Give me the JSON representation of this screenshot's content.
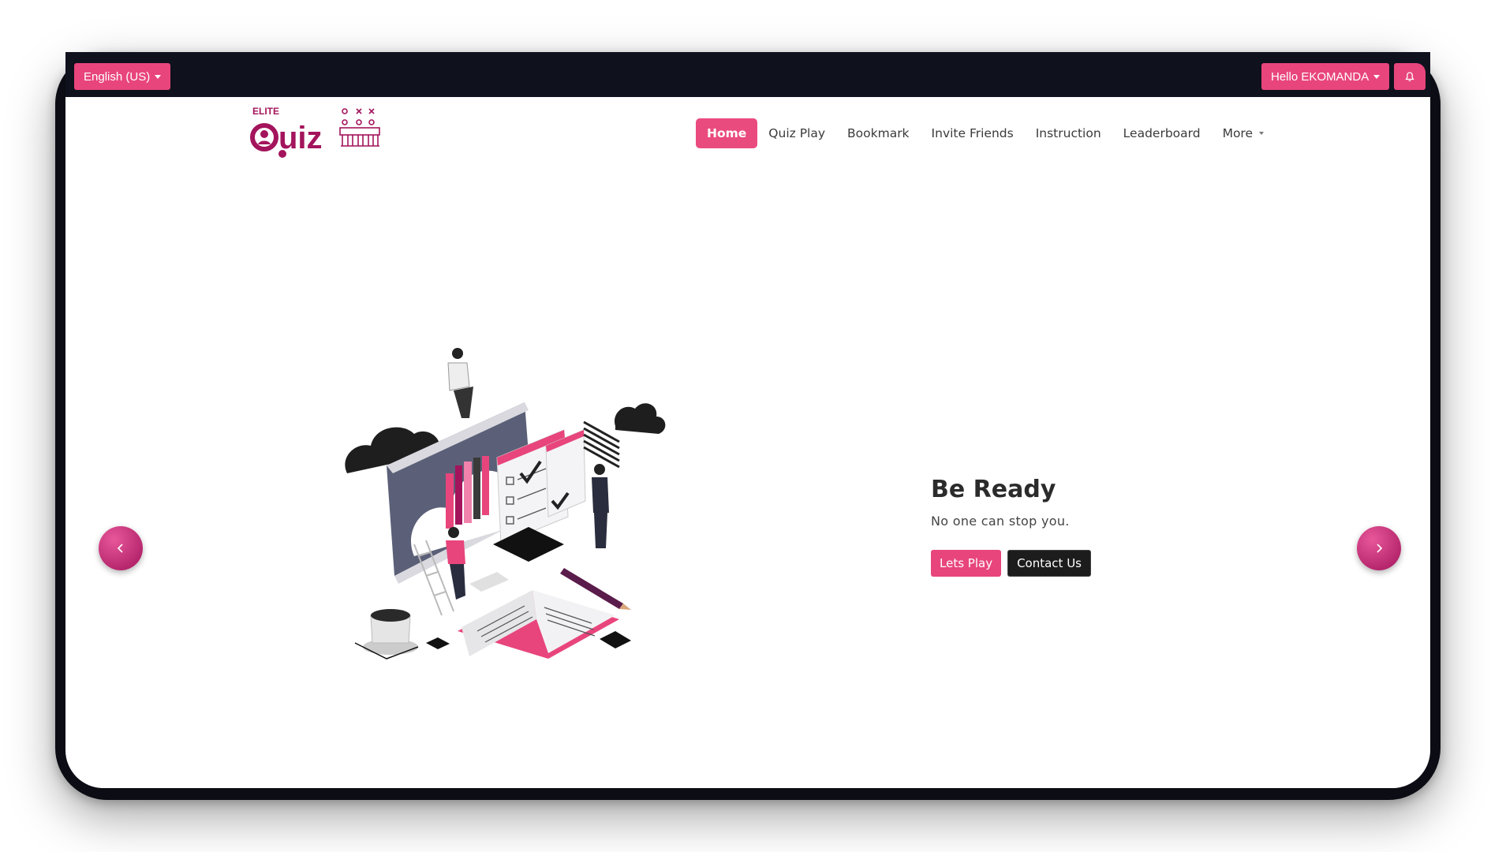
{
  "topbar": {
    "language_label": "English (US)",
    "user_label": "Hello EKOMANDA"
  },
  "logo": {
    "elite_text": "ELITE",
    "quiz_text": "Quiz"
  },
  "nav": {
    "items": [
      {
        "label": "Home"
      },
      {
        "label": "Quiz Play"
      },
      {
        "label": "Bookmark"
      },
      {
        "label": "Invite Friends"
      },
      {
        "label": "Instruction"
      },
      {
        "label": "Leaderboard"
      },
      {
        "label": "More"
      }
    ]
  },
  "hero": {
    "title": "Be Ready",
    "subtitle": "No one can stop you.",
    "primary_button": "Lets Play",
    "secondary_button": "Contact Us"
  },
  "colors": {
    "accent": "#e8457c",
    "dark": "#0f111d"
  },
  "icons": [
    "bell-icon",
    "chevron-left-icon",
    "chevron-right-icon",
    "caret-down-icon"
  ]
}
